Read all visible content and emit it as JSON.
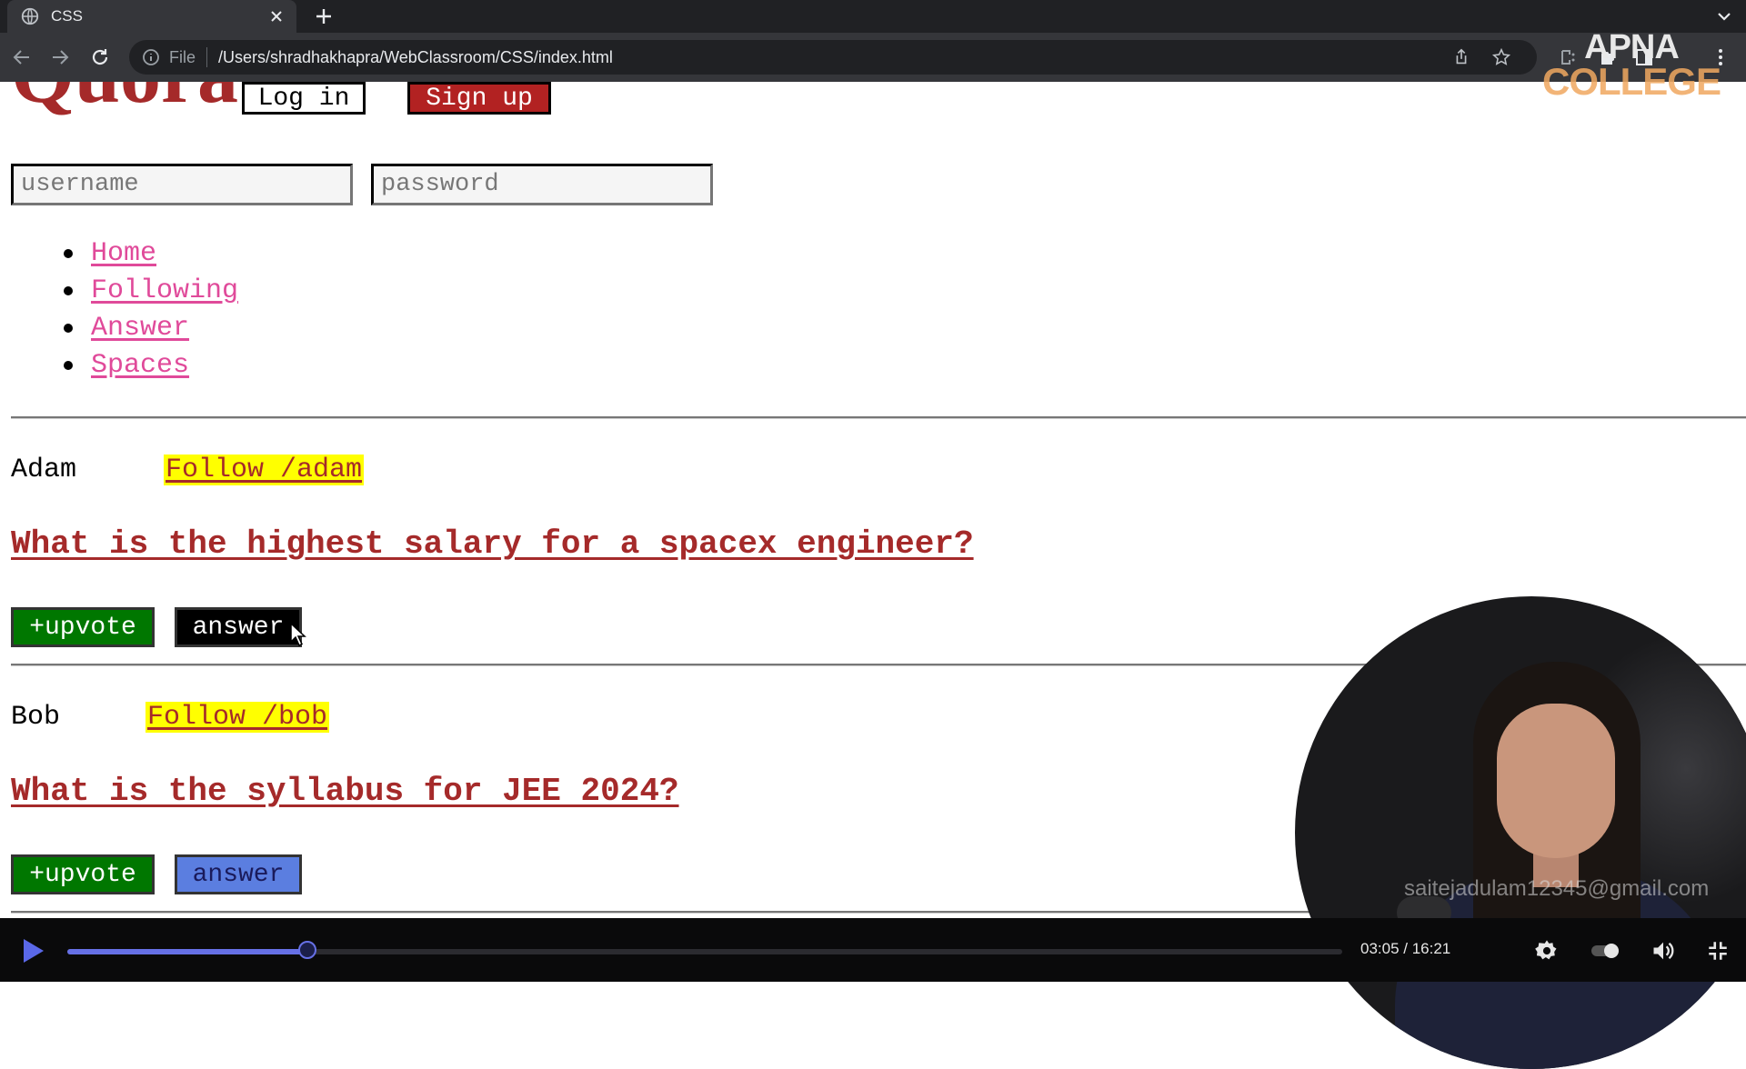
{
  "browser": {
    "tab_title": "CSS",
    "address_scheme": "File",
    "address_url": "/Users/shradhakhapra/WebClassroom/CSS/index.html"
  },
  "watermark": {
    "line1": "APNA",
    "line2": "COLLEGE"
  },
  "page": {
    "logo": "Quora",
    "login_label": "Log in",
    "signup_label": "Sign up",
    "username_placeholder": "username",
    "password_placeholder": "password",
    "nav": [
      {
        "label": "Home"
      },
      {
        "label": "Following"
      },
      {
        "label": "Answer"
      },
      {
        "label": "Spaces"
      }
    ],
    "posts": [
      {
        "user": "Adam",
        "follow": "Follow /adam",
        "question": "What is the highest salary for a spacex engineer?",
        "upvote": "+upvote",
        "answer": "answer",
        "answer_bg": "#000000",
        "answer_fg": "#ffffff"
      },
      {
        "user": "Bob",
        "follow": "Follow /bob",
        "question": "What is the syllabus for JEE 2024?",
        "upvote": "+upvote",
        "answer": "answer",
        "answer_bg": "#5b7ee0",
        "answer_fg": "#1a1a5a"
      }
    ]
  },
  "webcam": {
    "email_watermark": "saitejadulam12345@gmail.com"
  },
  "player": {
    "current_time": "03:05",
    "duration": "16:21",
    "time_label": "03:05 / 16:21",
    "progress_fraction": 0.1886,
    "accent_color": "#6670e6"
  },
  "icons": {
    "tab": "globe-icon",
    "controls": [
      "play-icon",
      "gear-icon",
      "toggle-icon",
      "volume-icon",
      "exit-fullscreen-icon"
    ]
  }
}
